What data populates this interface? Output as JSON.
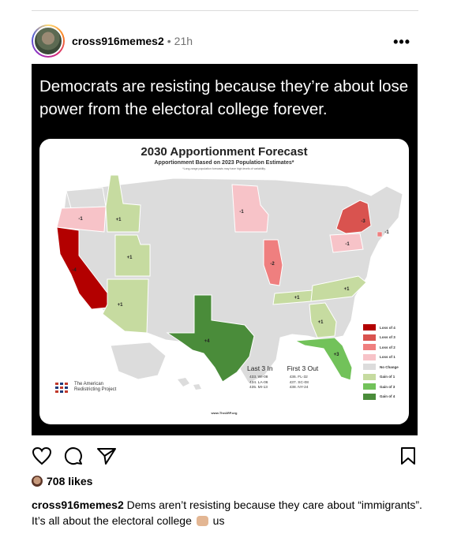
{
  "post": {
    "username": "cross916memes2",
    "separator": "•",
    "time": "21h",
    "more": "•••",
    "image": {
      "caption": "Democrats are resisting because they’re about lose power from the electoral college forever.",
      "map": {
        "title": "2030 Apportionment Forecast",
        "subtitle": "Apportionment Based on 2023 Population Estimates*",
        "note": "*Long-range population forecasts may have high levels of variability.",
        "legend": [
          {
            "label": "Loss of 4",
            "color": "#b30000"
          },
          {
            "label": "Loss of 3",
            "color": "#d9534f"
          },
          {
            "label": "Loss of 2",
            "color": "#ef7f7f"
          },
          {
            "label": "Loss of 1",
            "color": "#f7c3c8"
          },
          {
            "label": "No Change",
            "color": "#dcdcdc"
          },
          {
            "label": "Gain of 1",
            "color": "#c6dba0"
          },
          {
            "label": "Gain of 3",
            "color": "#72c25a"
          },
          {
            "label": "Gain of 4",
            "color": "#4a8c3a"
          }
        ],
        "state_labels": {
          "ca": "-4",
          "or": "-1",
          "id": "+1",
          "ut": "+1",
          "az": "+1",
          "tx": "+4",
          "mn": "-1",
          "il": "-2",
          "ny": "-3",
          "pa": "-1",
          "ri": "-1",
          "tn": "+1",
          "nc": "+1",
          "ga": "+1",
          "fl": "+3"
        },
        "last_in": {
          "title": "Last 3 In",
          "items": [
            "433. WI-08",
            "434. LA-06",
            "435. MI-13"
          ]
        },
        "first_out": {
          "title": "First 3 Out",
          "items": [
            "436. FL-32",
            "437. SC-08",
            "438. NY-24"
          ]
        },
        "org_name": "The American Redistricting Project",
        "url": "www.TheARP.org"
      }
    },
    "likes": "708 likes",
    "comment_user": "cross916memes2",
    "comment_text": "Dems aren’t resisting because they care about “immigrants”. It’s all about the electoral college",
    "comment_tail": "us"
  },
  "icons": {
    "like": "heart-icon",
    "comment": "comment-icon",
    "share": "share-icon",
    "save": "bookmark-icon"
  }
}
